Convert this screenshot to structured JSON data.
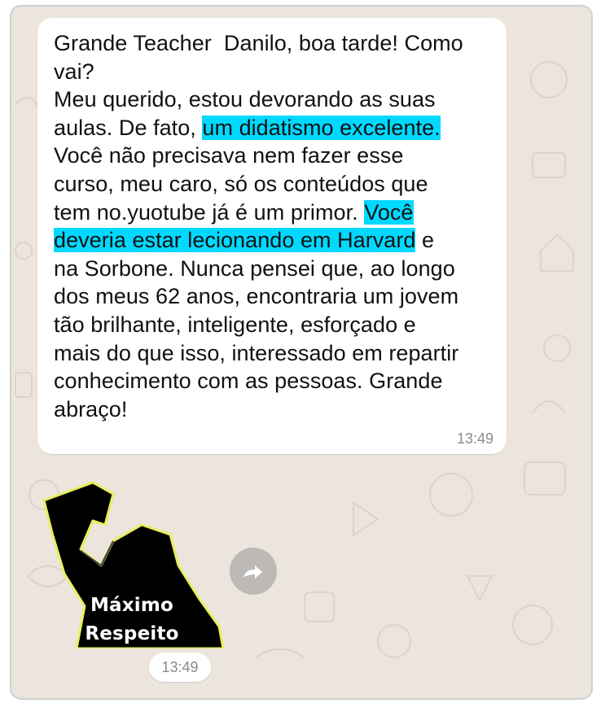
{
  "message": {
    "parts": [
      "Grande Teacher  Danilo, boa tarde! Como\nvai?\nMeu querido, estou devorando as suas\naulas. De fato, ",
      "um didatismo excelente.",
      "\nVocê não precisava nem fazer esse\ncurso, meu caro, só os conteúdos que\ntem no.yuotube já é um primor. ",
      "Você\ndeveria estar lecionando em Harvard",
      " e\nna Sorbone. Nunca pensei que, ao longo\ndos meus 62 anos, encontraria um jovem\ntão brilhante, inteligente, esforçado e\nmais do que isso, interessado em repartir\nconhecimento com as pessoas. Grande\nabraço!"
    ],
    "time": "13:49"
  },
  "sticker": {
    "line1": "Máximo",
    "line2": "Respeito",
    "time": "13:49"
  },
  "icons": {
    "forward": "forward-arrow-icon"
  },
  "colors": {
    "highlight": "#00d9ff",
    "chat_background": "#ece5dd",
    "bubble": "#ffffff"
  }
}
